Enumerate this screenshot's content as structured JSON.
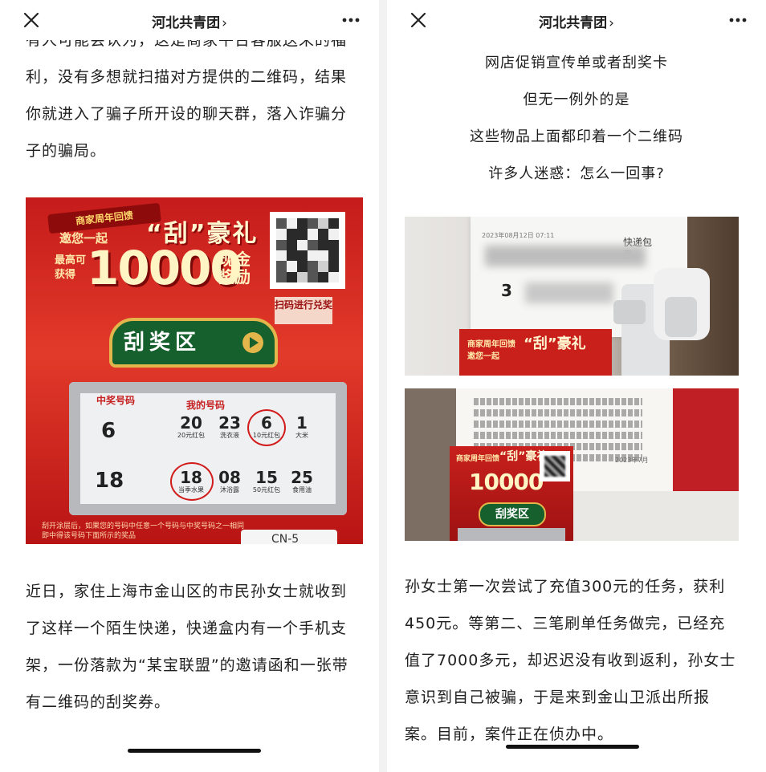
{
  "left_panel": {
    "nav": {
      "title": "河北共青团",
      "chevron": "›",
      "close_icon": "close-icon",
      "more_icon": "more-icon"
    },
    "paragraph_top": [
      "有人可能会认为，这是商家平台客服送来的福",
      "利，没有多想就扫描对方提供的二维码，结果",
      "你就进入了骗子所开设的聊天群，落入诈骗分",
      "子的骗局。"
    ],
    "scratch_card": {
      "ribbon": "商家周年回馈",
      "invite": "邀您一起",
      "headline": "“刮”豪礼",
      "max_label": "最高可获得",
      "amount": "10000",
      "cash": "现金奖励",
      "scan": "扫码进行兑奖",
      "area": "刮奖区",
      "win_header": "中奖号码",
      "mine_header": "我的号码",
      "winning_numbers": [
        "6",
        "18"
      ],
      "row1": [
        {
          "n": "20",
          "p": "20元红包"
        },
        {
          "n": "23",
          "p": "洗衣液"
        },
        {
          "n": "6",
          "p": "10元红包"
        },
        {
          "n": "1",
          "p": "大米"
        }
      ],
      "row2": [
        {
          "n": "18",
          "p": "当季水果"
        },
        {
          "n": "08",
          "p": "沐浴露"
        },
        {
          "n": "15",
          "p": "50元红包"
        },
        {
          "n": "25",
          "p": "食用油"
        }
      ],
      "footer": "刮开涂层后，如果您的号码中任意一个号码与中奖号码之一相同即中得该号码下面所示的奖品",
      "code": "CN-5"
    },
    "paragraph_bottom": [
      "近日，家住上海市金山区的市民孙女士就收到",
      "了这样一个陌生快递，快递盒内有一个手机支",
      "架，一份落款为“某宝联盟”的邀请函和一张带",
      "有二维码的刮奖券。"
    ]
  },
  "right_panel": {
    "nav": {
      "title": "河北共青团",
      "chevron": "›",
      "close_icon": "close-icon",
      "more_icon": "more-icon"
    },
    "center_lines": [
      "网店促销宣传单或者刮奖卡",
      "但无一例外的是",
      "这些物品上面都印着一个二维码",
      "许多人迷惑：怎么一回事?"
    ],
    "parcel_photo": {
      "express_label": "快递包裹",
      "date": "2023年08月12日 07:11",
      "digit": "3",
      "card_ribbon": "商家周年回馈",
      "card_invite": "邀您一起",
      "card_headline": "“刮”豪礼"
    },
    "desk_photo": {
      "date": "2023年7月",
      "card_ribbon": "商家周年回馈",
      "card_headline": "“刮”豪礼",
      "card_amount": "10000",
      "card_area": "刮奖区"
    },
    "paragraph": [
      "孙女士第一次尝试了充值300元的任务，获利",
      "450元。等第二、三笔刷单任务做完，已经充",
      "值了7000多元，却迟迟没有收到返利，孙女士",
      "意识到自己被骗，于是来到金山卫派出所报",
      "案。目前，案件正在侦办中。"
    ]
  }
}
